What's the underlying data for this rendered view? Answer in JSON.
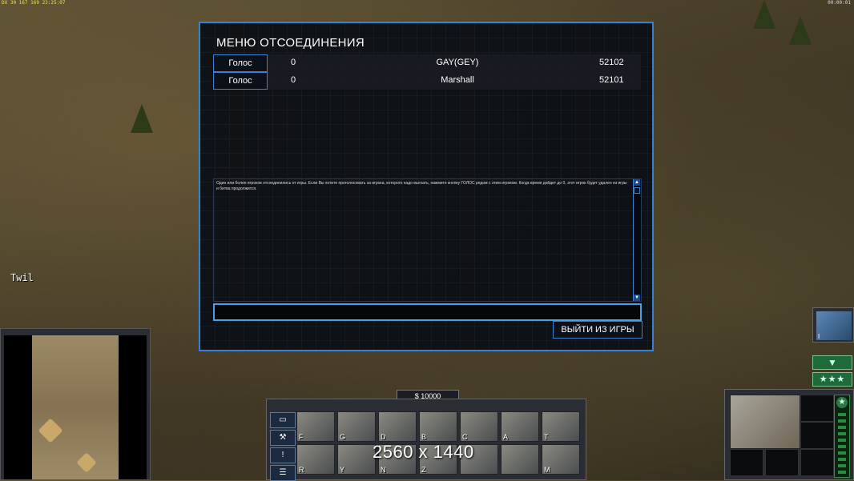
{
  "hud": {
    "top_left_stats": "DX 30 167 169 23:25:07",
    "top_right_timer": "00:00:01",
    "player_label": "Twil",
    "money": "$ 10000",
    "resolution_overlay": "2560 x 1440"
  },
  "dialog": {
    "title": "МЕНЮ ОТСОЕДИНЕНИЯ",
    "players": [
      {
        "vote_label": "Голос",
        "votes": "0",
        "name": "GAY(GEY)",
        "port": "52102"
      },
      {
        "vote_label": "Голос",
        "votes": "0",
        "name": "Marshall",
        "port": "52101"
      }
    ],
    "message": "Один или более игроков отсоединились от игры. Если Вы хотите проголосовать за игрока, которого надо выгнать, нажмите кнопку ГОЛОС рядом с этим игроком. Когда время дойдет до 0, этот игрок будет удален из игры и битва продолжится.",
    "quit_label": "ВЫЙТИ ИЗ ИГРЫ"
  },
  "command_bar": {
    "hotkeys_row1": [
      "F",
      "G",
      "D",
      "B",
      "C",
      "A",
      "T"
    ],
    "hotkeys_row2": [
      "R",
      "Y",
      "N",
      "Z",
      "",
      "",
      "M"
    ]
  },
  "right_panel": {
    "satellite_key": "I",
    "rank_stars": "★★★"
  },
  "colors": {
    "dialog_border": "#3a80d0",
    "rank_green": "#1e6a3a"
  }
}
